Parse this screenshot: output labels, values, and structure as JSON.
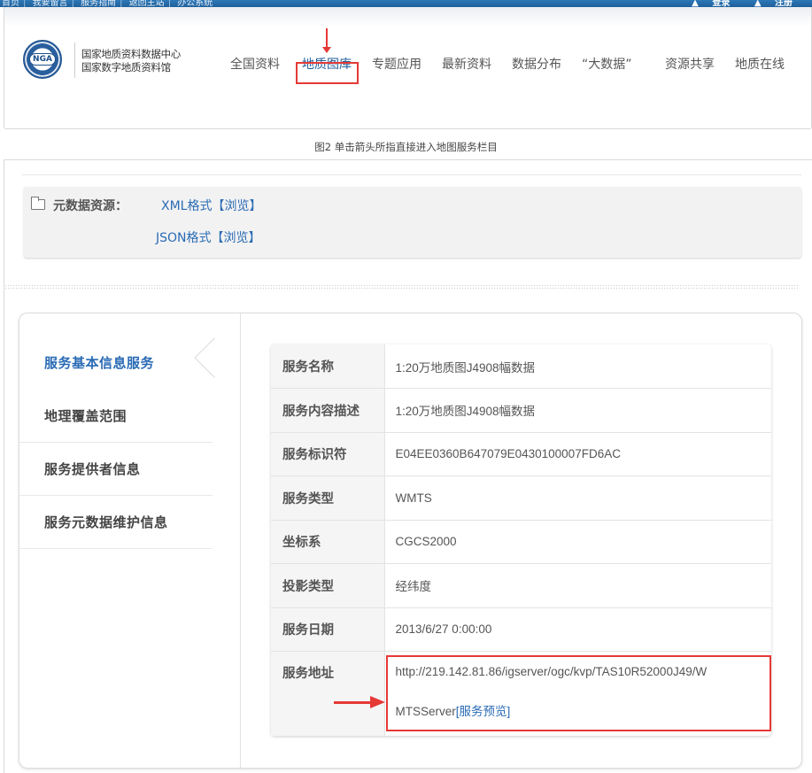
{
  "topbar": {
    "links": [
      "首页",
      "我要留言",
      "服务指南",
      "返回主站",
      "办公系统"
    ],
    "login": "登录",
    "register": "注册"
  },
  "logo": {
    "text": "NGA"
  },
  "org": {
    "line1": "国家地质资料数据中心",
    "line2": "国家数字地质资料馆"
  },
  "nav": {
    "items": [
      "全国资料",
      "地质图库",
      "专题应用",
      "最新资料",
      "数据分布",
      "“大数据”",
      "资源共享",
      "地质在线"
    ],
    "highlighted": "地质图库"
  },
  "caption": "图2 单击箭头所指直接进入地图服务栏目",
  "metadata": {
    "label": "元数据资源：",
    "xml_format": "XML格式",
    "json_format": "JSON格式",
    "browse": "【浏览】"
  },
  "sidebar": {
    "items": [
      {
        "label": "服务基本信息服务",
        "active": true
      },
      {
        "label": "地理覆盖范围",
        "active": false
      },
      {
        "label": "服务提供者信息",
        "active": false
      },
      {
        "label": "服务元数据维护信息",
        "active": false
      }
    ]
  },
  "info_table": {
    "rows": [
      {
        "key": "服务名称",
        "value": "1:20万地质图J4908幅数据"
      },
      {
        "key": "服务内容描述",
        "value": "1:20万地质图J4908幅数据"
      },
      {
        "key": "服务标识符",
        "value": "E04EE0360B647079E0430100007FD6AC"
      },
      {
        "key": "服务类型",
        "value": "WMTS"
      },
      {
        "key": "坐标系",
        "value": "CGCS2000"
      },
      {
        "key": "投影类型",
        "value": "经纬度"
      },
      {
        "key": "服务日期",
        "value": "2013/6/27 0:00:00"
      }
    ],
    "address": {
      "key": "服务地址",
      "line1": "http://219.142.81.86/igserver/ogc/kvp/TAS10R52000J49/W",
      "line2": "MTSServer",
      "preview_link": "[服务预览]"
    }
  },
  "colors": {
    "accent": "#2a6bb5",
    "annotation_red": "#e53935",
    "topbar_blue": "#1f5f9a"
  }
}
